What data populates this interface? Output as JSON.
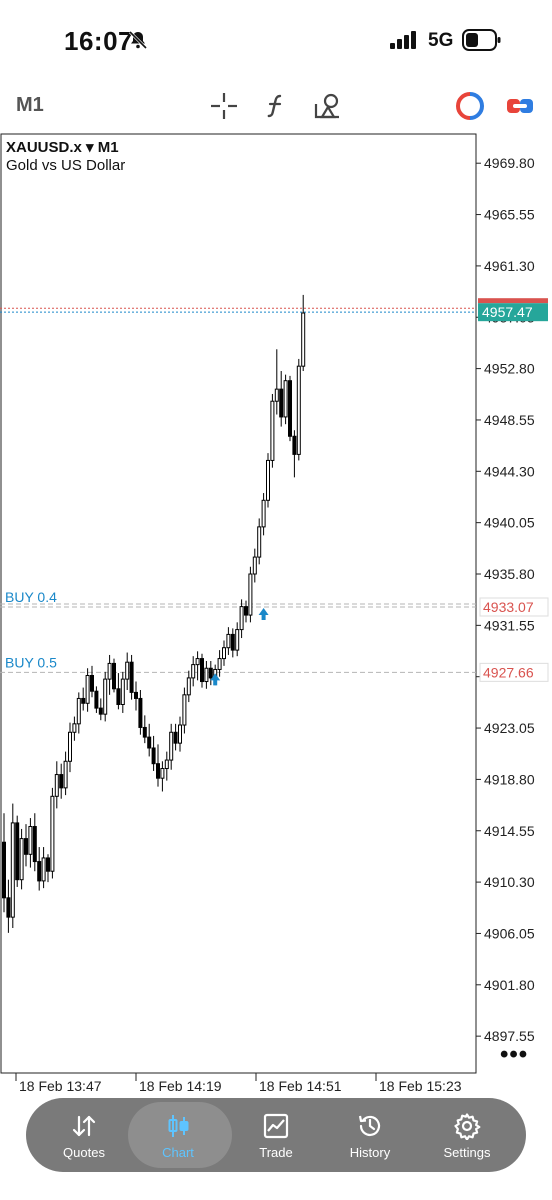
{
  "status": {
    "time": "16:07",
    "network": "5G"
  },
  "toolbar": {
    "timeframe": "M1"
  },
  "chart_header": {
    "symbol": "XAUUSD.x ▾ M1",
    "description": "Gold vs US Dollar"
  },
  "chart_data": {
    "type": "candlestick",
    "symbol": "XAUUSD.x",
    "timeframe": "M1",
    "description": "Gold vs US Dollar",
    "ylim": [
      4894.5,
      4972.3
    ],
    "y_ticks": [
      "4969.80",
      "4965.55",
      "4961.30",
      "4957.05",
      "4952.80",
      "4948.55",
      "4944.30",
      "4940.05",
      "4935.80",
      "4931.55",
      "4927.30",
      "4923.05",
      "4918.80",
      "4914.55",
      "4910.30",
      "4906.05",
      "4901.80",
      "4897.55"
    ],
    "x_tick_labels": [
      "18 Feb 13:47",
      "18 Feb 14:19",
      "18 Feb 14:51",
      "18 Feb 15:23"
    ],
    "current_price": "4957.47",
    "ask_line": 4957.8,
    "position_lines": [
      {
        "label": "BUY 0.4",
        "price": "4933.07"
      },
      {
        "label": "BUY 0.5",
        "price": "4927.66"
      }
    ],
    "candles": [
      [
        4913.6,
        4916.0,
        4907.8,
        4909.0
      ],
      [
        4909.0,
        4910.5,
        4906.1,
        4907.4
      ],
      [
        4907.4,
        4916.8,
        4906.5,
        4915.2
      ],
      [
        4915.2,
        4915.8,
        4909.9,
        4910.5
      ],
      [
        4910.5,
        4914.7,
        4909.7,
        4913.9
      ],
      [
        4913.9,
        4915.1,
        4911.6,
        4912.6
      ],
      [
        4912.6,
        4915.6,
        4911.5,
        4914.9
      ],
      [
        4914.9,
        4916.0,
        4911.2,
        4912.0
      ],
      [
        4912.0,
        4913.2,
        4909.6,
        4910.4
      ],
      [
        4910.4,
        4913.2,
        4909.8,
        4912.3
      ],
      [
        4912.3,
        4912.6,
        4910.3,
        4911.2
      ],
      [
        4911.2,
        4918.1,
        4910.6,
        4917.4
      ],
      [
        4917.4,
        4920.3,
        4916.4,
        4919.2
      ],
      [
        4919.2,
        4920.1,
        4917.2,
        4918.1
      ],
      [
        4918.1,
        4921.1,
        4917.5,
        4920.3
      ],
      [
        4920.3,
        4923.5,
        4919.4,
        4922.7
      ],
      [
        4922.7,
        4924.0,
        4922.0,
        4923.4
      ],
      [
        4923.4,
        4926.0,
        4922.6,
        4925.5
      ],
      [
        4925.5,
        4926.4,
        4924.5,
        4925.1
      ],
      [
        4925.1,
        4928.0,
        4924.4,
        4927.4
      ],
      [
        4927.4,
        4928.2,
        4925.6,
        4926.1
      ],
      [
        4926.1,
        4926.5,
        4924.3,
        4924.7
      ],
      [
        4924.7,
        4925.5,
        4923.7,
        4924.2
      ],
      [
        4924.2,
        4927.7,
        4923.6,
        4927.1
      ],
      [
        4927.1,
        4929.1,
        4925.8,
        4928.4
      ],
      [
        4928.4,
        4928.8,
        4926.0,
        4926.3
      ],
      [
        4926.3,
        4927.6,
        4924.6,
        4925.0
      ],
      [
        4925.0,
        4927.7,
        4924.3,
        4927.1
      ],
      [
        4927.1,
        4929.3,
        4926.2,
        4928.5
      ],
      [
        4928.5,
        4929.1,
        4925.4,
        4926.0
      ],
      [
        4926.0,
        4926.9,
        4924.5,
        4925.5
      ],
      [
        4925.5,
        4926.2,
        4922.5,
        4923.1
      ],
      [
        4923.1,
        4924.1,
        4921.8,
        4922.3
      ],
      [
        4922.3,
        4923.4,
        4920.7,
        4921.4
      ],
      [
        4921.4,
        4922.4,
        4919.5,
        4920.1
      ],
      [
        4920.1,
        4921.7,
        4918.2,
        4918.9
      ],
      [
        4918.9,
        4920.3,
        4917.8,
        4919.7
      ],
      [
        4919.7,
        4921.1,
        4918.7,
        4920.4
      ],
      [
        4920.4,
        4923.4,
        4919.6,
        4922.7
      ],
      [
        4922.7,
        4923.4,
        4921.2,
        4921.8
      ],
      [
        4921.8,
        4924.0,
        4921.1,
        4923.3
      ],
      [
        4923.3,
        4926.4,
        4922.6,
        4925.8
      ],
      [
        4925.8,
        4927.8,
        4925.2,
        4927.2
      ],
      [
        4927.2,
        4929.0,
        4926.5,
        4928.3
      ],
      [
        4928.3,
        4929.4,
        4927.0,
        4928.8
      ],
      [
        4928.8,
        4929.2,
        4926.4,
        4926.9
      ],
      [
        4926.9,
        4928.6,
        4926.3,
        4928.0
      ],
      [
        4928.0,
        4928.6,
        4926.6,
        4927.2
      ],
      [
        4927.2,
        4928.3,
        4926.6,
        4927.9
      ],
      [
        4927.9,
        4929.5,
        4927.3,
        4928.8
      ],
      [
        4928.8,
        4930.3,
        4928.2,
        4929.7
      ],
      [
        4929.7,
        4931.4,
        4929.1,
        4930.8
      ],
      [
        4930.8,
        4931.3,
        4928.9,
        4929.5
      ],
      [
        4929.5,
        4931.8,
        4929.0,
        4931.2
      ],
      [
        4931.2,
        4933.7,
        4930.5,
        4933.1
      ],
      [
        4933.1,
        4933.6,
        4931.8,
        4932.4
      ],
      [
        4932.4,
        4936.4,
        4931.8,
        4935.8
      ],
      [
        4935.8,
        4937.9,
        4935.1,
        4937.2
      ],
      [
        4937.2,
        4940.4,
        4936.6,
        4939.7
      ],
      [
        4939.7,
        4942.5,
        4939.0,
        4941.9
      ],
      [
        4941.9,
        4945.8,
        4941.3,
        4945.2
      ],
      [
        4945.2,
        4950.7,
        4944.6,
        4950.1
      ],
      [
        4950.1,
        4954.4,
        4949.0,
        4951.1
      ],
      [
        4951.1,
        4952.6,
        4948.0,
        4948.8
      ],
      [
        4948.8,
        4952.3,
        4948.2,
        4951.8
      ],
      [
        4951.8,
        4952.2,
        4946.8,
        4947.2
      ],
      [
        4947.2,
        4947.7,
        4943.8,
        4945.7
      ],
      [
        4945.7,
        4953.6,
        4945.2,
        4953.0
      ],
      [
        4953.0,
        4958.9,
        4952.6,
        4957.4
      ]
    ]
  },
  "nav": {
    "items": [
      {
        "label": "Quotes"
      },
      {
        "label": "Chart"
      },
      {
        "label": "Trade"
      },
      {
        "label": "History"
      },
      {
        "label": "Settings"
      }
    ]
  },
  "colors": {
    "bid_line": "#1a88c9",
    "ask_line": "#d9534f",
    "price_tag": "#26a69a",
    "active_tab": "#5ec4ff"
  }
}
